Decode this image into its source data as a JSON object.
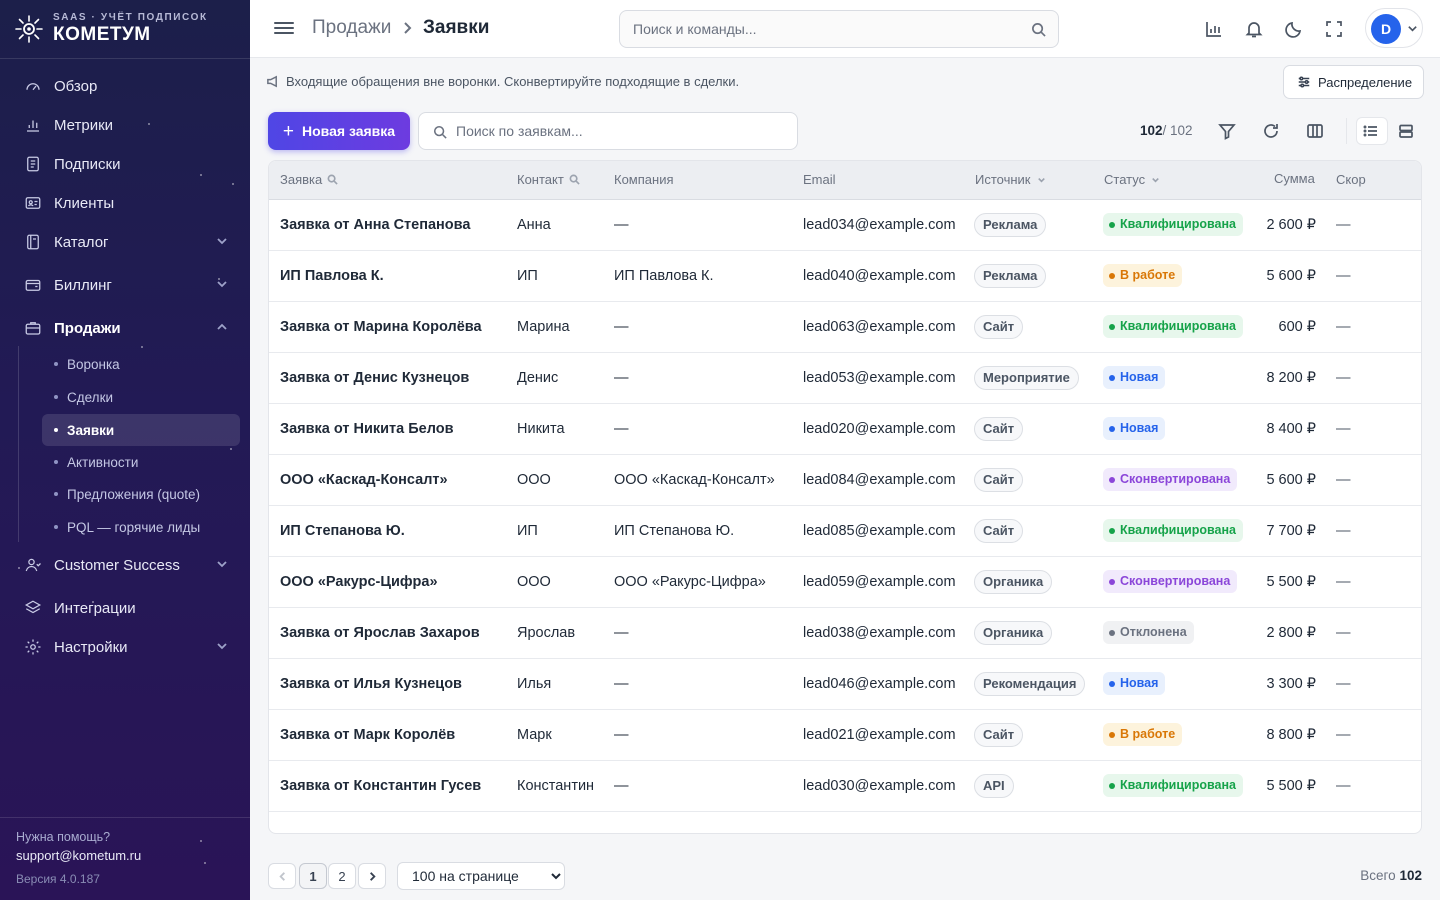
{
  "brand": {
    "subtitle": "SAAS · УЧЁТ ПОДПИСОК",
    "name": "КОМЕТУМ"
  },
  "sidebar": {
    "items": [
      {
        "label": "Обзор",
        "icon": "gauge-icon"
      },
      {
        "label": "Метрики",
        "icon": "bar-chart-icon"
      },
      {
        "label": "Подписки",
        "icon": "document-icon"
      },
      {
        "label": "Клиенты",
        "icon": "id-card-icon"
      },
      {
        "label": "Каталог",
        "icon": "catalog-icon"
      },
      {
        "label": "Биллинг",
        "icon": "wallet-icon"
      },
      {
        "label": "Продажи",
        "icon": "briefcase-icon"
      },
      {
        "label": "Customer Success",
        "icon": "users-icon"
      },
      {
        "label": "Интеграции",
        "icon": "layers-icon"
      },
      {
        "label": "Настройки",
        "icon": "gear-icon"
      }
    ],
    "sales_sub": [
      "Воронка",
      "Сделки",
      "Заявки",
      "Активности",
      "Предложения (quote)",
      "PQL — горячие лиды"
    ],
    "help_label": "Нужна помощь?",
    "help_email": "support@kometum.ru",
    "version": "Версия 4.0.187"
  },
  "header": {
    "crumb_parent": "Продажи",
    "crumb_current": "Заявки",
    "search_placeholder": "Поиск и команды...",
    "user_initial": "D"
  },
  "info": {
    "text": "Входящие обращения вне воронки. Сконвертируйте подходящие в сделки.",
    "distribution_label": "Распределение"
  },
  "toolbar": {
    "new_label": "Новая заявка",
    "search_placeholder": "Поиск по заявкам...",
    "count_shown": "102",
    "count_total": "/ 102"
  },
  "table": {
    "columns": [
      "Заявка",
      "Контакт",
      "Компания",
      "Email",
      "Источник",
      "Статус",
      "Сумма",
      "Скор"
    ],
    "status_colors": {
      "Квалифицирована": {
        "bg": "#e7f7ec",
        "fg": "#16a34a"
      },
      "В работе": {
        "bg": "#fdf3dc",
        "fg": "#d97706"
      },
      "Новая": {
        "bg": "#e8f0fd",
        "fg": "#2563eb"
      },
      "Сконвертирована": {
        "bg": "#f1eafc",
        "fg": "#8b46d9"
      },
      "Отклонена": {
        "bg": "#f0f1f3",
        "fg": "#6b7280"
      }
    },
    "rows": [
      {
        "title": "Заявка от Анна Степанова",
        "contact": "Анна",
        "company": "—",
        "email": "lead034@example.com",
        "source": "Реклама",
        "status": "Квалифицирована",
        "amount": "2 600 ₽",
        "score": "—"
      },
      {
        "title": "ИП Павлова К.",
        "contact": "ИП",
        "company": "ИП Павлова К.",
        "email": "lead040@example.com",
        "source": "Реклама",
        "status": "В работе",
        "amount": "5 600 ₽",
        "score": "—"
      },
      {
        "title": "Заявка от Марина Королёва",
        "contact": "Марина",
        "company": "—",
        "email": "lead063@example.com",
        "source": "Сайт",
        "status": "Квалифицирована",
        "amount": "600 ₽",
        "score": "—"
      },
      {
        "title": "Заявка от Денис Кузнецов",
        "contact": "Денис",
        "company": "—",
        "email": "lead053@example.com",
        "source": "Мероприятие",
        "status": "Новая",
        "amount": "8 200 ₽",
        "score": "—"
      },
      {
        "title": "Заявка от Никита Белов",
        "contact": "Никита",
        "company": "—",
        "email": "lead020@example.com",
        "source": "Сайт",
        "status": "Новая",
        "amount": "8 400 ₽",
        "score": "—"
      },
      {
        "title": "ООО «Каскад-Консалт»",
        "contact": "ООО",
        "company": "ООО «Каскад-Консалт»",
        "email": "lead084@example.com",
        "source": "Сайт",
        "status": "Сконвертирована",
        "amount": "5 600 ₽",
        "score": "—"
      },
      {
        "title": "ИП Степанова Ю.",
        "contact": "ИП",
        "company": "ИП Степанова Ю.",
        "email": "lead085@example.com",
        "source": "Сайт",
        "status": "Квалифицирована",
        "amount": "7 700 ₽",
        "score": "—"
      },
      {
        "title": "ООО «Ракурс-Цифра»",
        "contact": "ООО",
        "company": "ООО «Ракурс-Цифра»",
        "email": "lead059@example.com",
        "source": "Органика",
        "status": "Сконвертирована",
        "amount": "5 500 ₽",
        "score": "—"
      },
      {
        "title": "Заявка от Ярослав Захаров",
        "contact": "Ярослав",
        "company": "—",
        "email": "lead038@example.com",
        "source": "Органика",
        "status": "Отклонена",
        "amount": "2 800 ₽",
        "score": "—"
      },
      {
        "title": "Заявка от Илья Кузнецов",
        "contact": "Илья",
        "company": "—",
        "email": "lead046@example.com",
        "source": "Рекомендация",
        "status": "Новая",
        "amount": "3 300 ₽",
        "score": "—"
      },
      {
        "title": "Заявка от Марк Королёв",
        "contact": "Марк",
        "company": "—",
        "email": "lead021@example.com",
        "source": "Сайт",
        "status": "В работе",
        "amount": "8 800 ₽",
        "score": "—"
      },
      {
        "title": "Заявка от Константин Гусев",
        "contact": "Константин",
        "company": "—",
        "email": "lead030@example.com",
        "source": "API",
        "status": "Квалифицирована",
        "amount": "5 500 ₽",
        "score": "—"
      }
    ]
  },
  "pagination": {
    "pages": [
      "1",
      "2"
    ],
    "per_page": "100 на странице",
    "total_label": "Всего",
    "total_value": "102"
  }
}
